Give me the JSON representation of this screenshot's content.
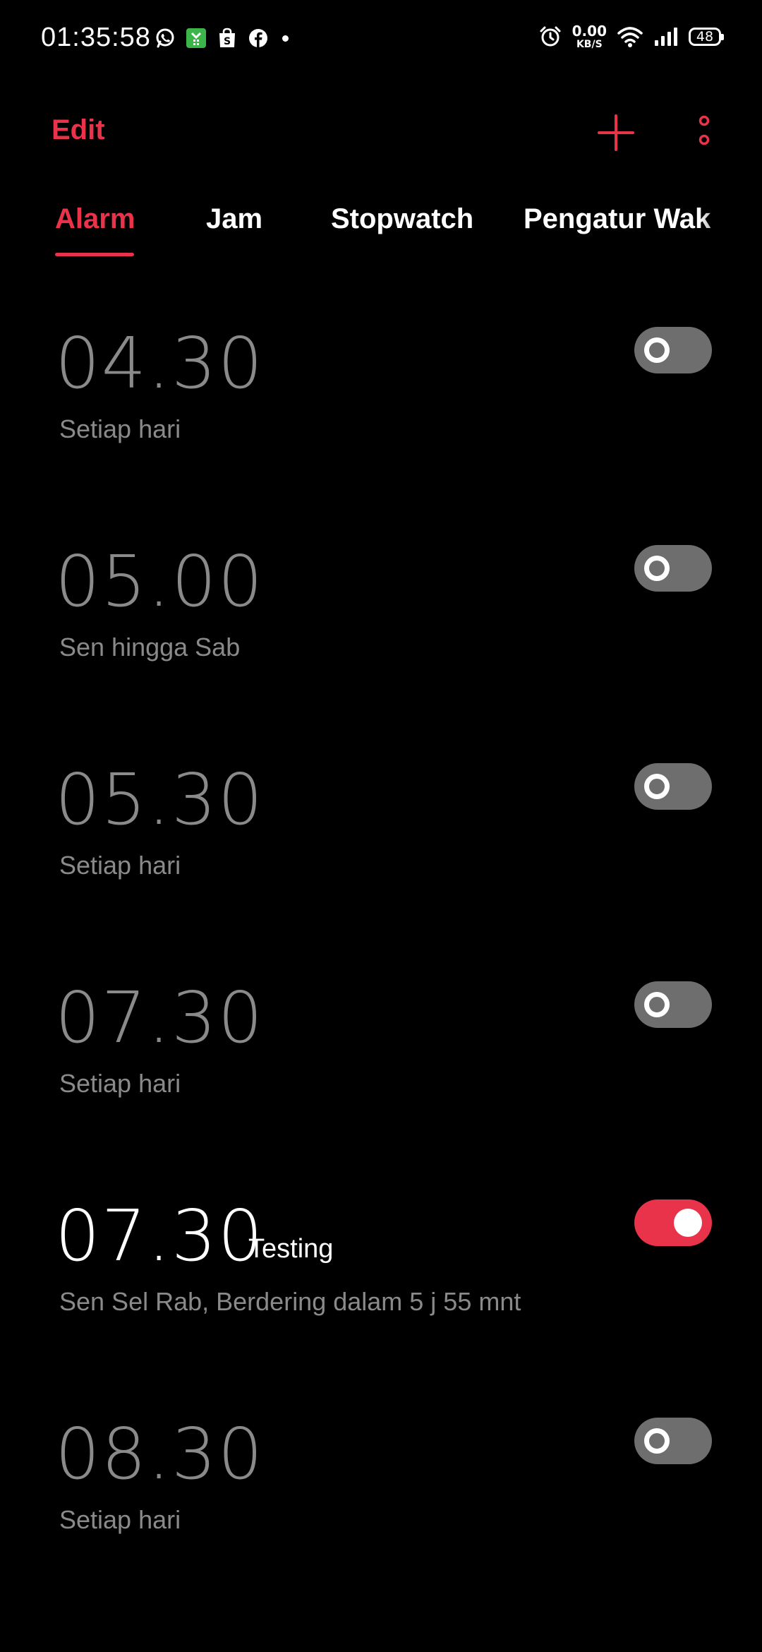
{
  "status_bar": {
    "time": "01:35:58",
    "notification_icons": [
      "whatsapp-icon",
      "shopping-bag-icon",
      "shop-icon",
      "facebook-icon"
    ],
    "net_speed_value": "0.00",
    "net_speed_unit": "KB/S",
    "battery": "48"
  },
  "toolbar": {
    "edit_label": "Edit",
    "add_icon": "plus-icon",
    "more_icon": "more-vertical-icon"
  },
  "tabs": [
    {
      "label": "Alarm",
      "active": true
    },
    {
      "label": "Jam",
      "active": false
    },
    {
      "label": "Stopwatch",
      "active": false
    },
    {
      "label": "Pengatur Wak",
      "active": false
    }
  ],
  "alarms": [
    {
      "time": "04.30",
      "label": "",
      "repeat": "Setiap hari",
      "enabled": false
    },
    {
      "time": "05.00",
      "label": "",
      "repeat": "Sen hingga Sab",
      "enabled": false
    },
    {
      "time": "05.30",
      "label": "",
      "repeat": "Setiap hari",
      "enabled": false
    },
    {
      "time": "07.30",
      "label": "",
      "repeat": "Setiap hari",
      "enabled": false
    },
    {
      "time": "07.30",
      "label": "Testing",
      "repeat": "Sen Sel Rab, Berdering dalam 5 j 55 mnt",
      "enabled": true
    },
    {
      "time": "08.30",
      "label": "",
      "repeat": "Setiap hari",
      "enabled": false
    }
  ],
  "colors": {
    "accent": "#e8334a",
    "background": "#000000",
    "disabled_text": "#8a8a8a",
    "toggle_off": "#6e6e6e"
  }
}
